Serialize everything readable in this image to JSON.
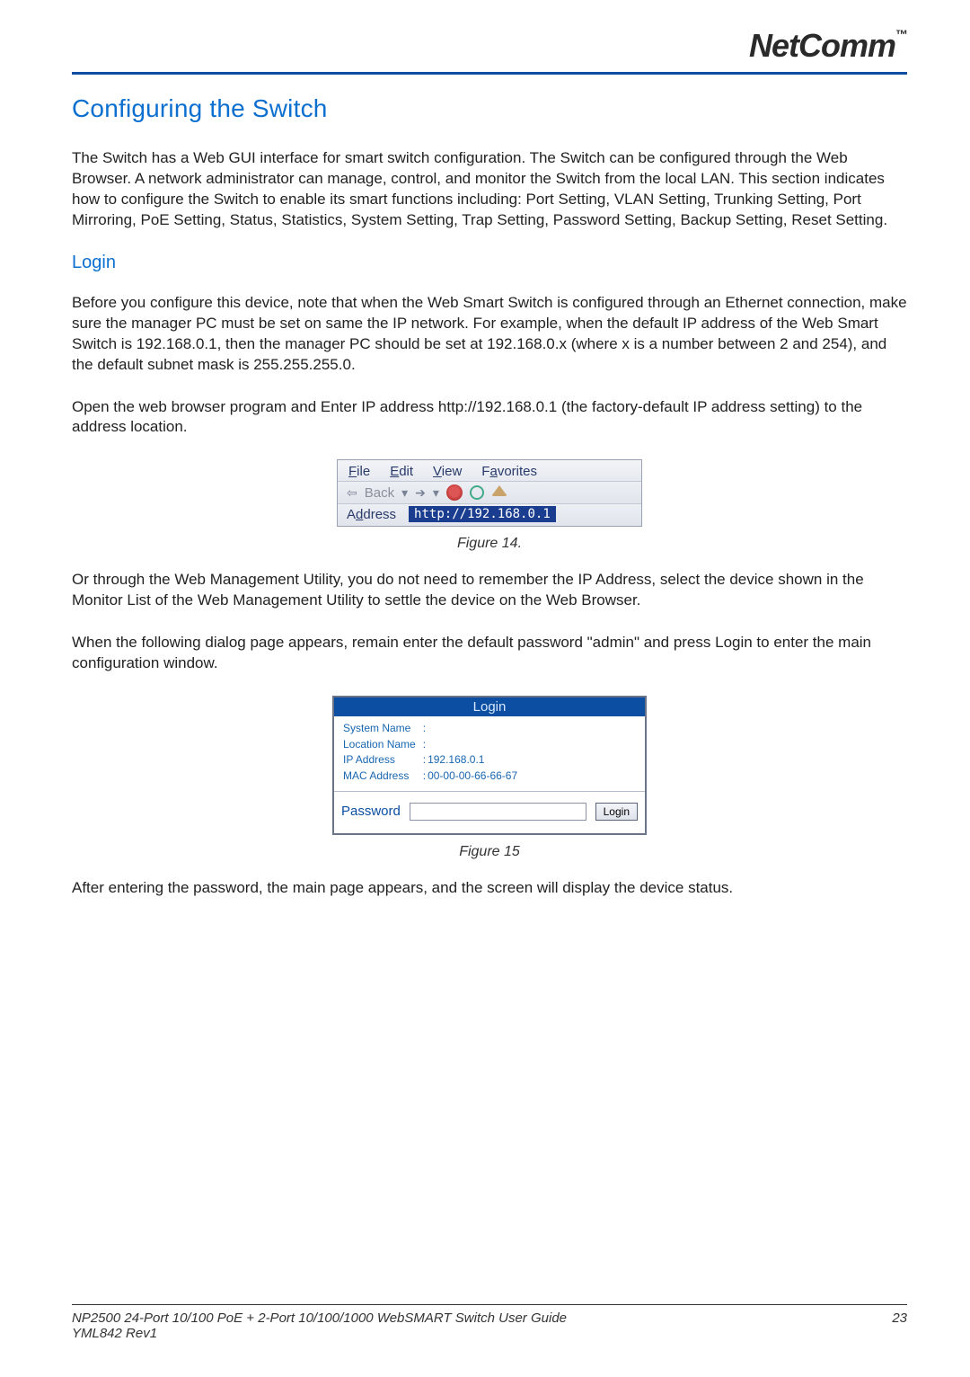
{
  "brand": {
    "name": "NetComm",
    "tm": "™"
  },
  "headings": {
    "h1": "Configuring the Switch",
    "h2_login": "Login"
  },
  "paragraphs": {
    "intro": "The Switch has a Web GUI interface for smart switch configuration. The Switch can be configured through the Web Browser. A network administrator can manage, control, and monitor the Switch from the local LAN. This section indicates how to configure the Switch to enable its smart functions including: Port Setting, VLAN Setting, Trunking Setting, Port Mirroring, PoE Setting, Status, Statistics, System Setting, Trap Setting, Password Setting, Backup Setting, Reset Setting.",
    "login1": "Before you configure this device, note that when the Web Smart Switch is configured through an Ethernet connection, make sure the manager PC must be set on same the IP network. For example, when the default IP address of the Web Smart Switch is 192.168.0.1, then the manager PC should be set at 192.168.0.x (where x is a number between 2 and 254), and the default subnet mask is 255.255.255.0.",
    "login2": "Open the web browser program and Enter IP address http://192.168.0.1 (the factory-default IP address setting) to the address location.",
    "after_fig14": "Or through the Web Management Utility, you do not need to remember the IP Address, select the device shown in the Monitor List of the Web Management Utility to settle the device on the Web Browser.",
    "before_fig15": "When the following dialog page appears, remain enter the default password \"admin\" and press Login to enter the main configuration window.",
    "after_fig15": "After entering the password, the main page appears, and the screen will display the device status."
  },
  "fig14": {
    "menu": {
      "file": "File",
      "edit": "Edit",
      "view": "View",
      "favorites": "Favorites"
    },
    "back_label": "Back",
    "address_label": "Address",
    "url": "http://192.168.0.1",
    "caption": "Figure 14."
  },
  "fig15": {
    "title": "Login",
    "rows": {
      "system_name_label": "System Name",
      "system_name_value": "",
      "location_name_label": "Location Name",
      "location_name_value": "",
      "ip_label": "IP Address",
      "ip_value": "192.168.0.1",
      "mac_label": "MAC Address",
      "mac_value": "00-00-00-66-66-67"
    },
    "password_label": "Password",
    "login_button": "Login",
    "caption": "Figure 15"
  },
  "footer": {
    "guide": "NP2500 24-Port 10/100 PoE + 2-Port 10/100/1000 WebSMART Switch User Guide",
    "doc": "YML842 Rev1",
    "page": "23"
  }
}
